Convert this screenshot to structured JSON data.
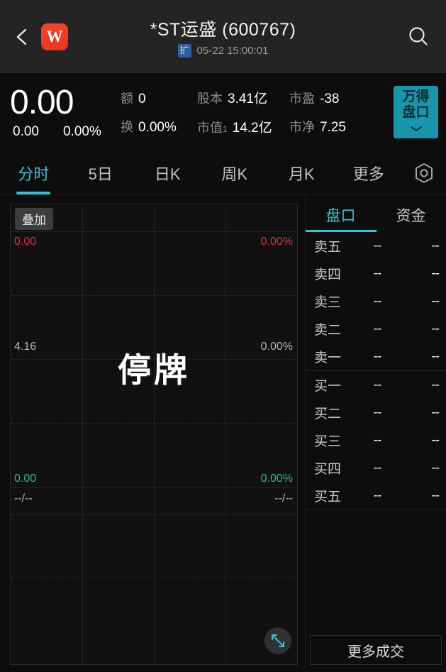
{
  "header": {
    "back_icon": "chevron-left-icon",
    "logo_letter": "W",
    "title": "*ST运盛 (600767)",
    "badge": "扩",
    "timestamp": "05-22 15:00:01",
    "search_icon": "search-icon"
  },
  "quote": {
    "price": "0.00",
    "change": "0.00",
    "change_pct": "0.00%",
    "stats": [
      {
        "key": "额",
        "sup": "",
        "value": "0"
      },
      {
        "key": "换",
        "sup": "",
        "value": "0.00%"
      },
      {
        "key": "股本",
        "sup": "",
        "value": "3.41亿"
      },
      {
        "key": "市值",
        "sup": "1",
        "value": "14.2亿"
      },
      {
        "key": "市盈",
        "sup": "",
        "value": "-38"
      },
      {
        "key": "市净",
        "sup": "",
        "value": "7.25"
      }
    ],
    "wind_button": {
      "line1": "万得",
      "line2": "盘口",
      "chevron": "chevron-down-icon"
    },
    "accent": "#1995ab"
  },
  "tabs": {
    "items": [
      {
        "label": "分时",
        "active": true
      },
      {
        "label": "5日",
        "active": false
      },
      {
        "label": "日K",
        "active": false
      },
      {
        "label": "周K",
        "active": false
      },
      {
        "label": "月K",
        "active": false
      },
      {
        "label": "更多",
        "active": false
      }
    ],
    "settings_icon": "gear-hex-icon",
    "accent": "#2ec5d8"
  },
  "chart": {
    "overlay_button": "叠加",
    "halt_text": "停牌",
    "expand_icon": "expand-diagonal-icon",
    "labels": {
      "top_left": "0.00",
      "top_right": "0.00%",
      "mid_left": "4.16",
      "mid_right": "0.00%",
      "bottom_left": "0.00",
      "bottom_right": "0.00%",
      "vol_left": "--/--",
      "vol_right": "--/--"
    },
    "colors": {
      "up": "#e62e2e",
      "down": "#1fc17b",
      "neutral": "#b5b5b5"
    }
  },
  "chart_data": {
    "type": "line",
    "title": "分时",
    "xlabel": "",
    "ylabel": "",
    "series": [],
    "ylim": [
      4.16,
      4.16
    ],
    "price_axis_labels": [
      "0.00",
      "4.16",
      "0.00"
    ],
    "pct_axis_labels": [
      "0.00%",
      "0.00%",
      "0.00%"
    ],
    "volume_axis_labels": [
      "--/--",
      "--/--"
    ],
    "grid": true,
    "note": "停牌 — trading suspended, no intraday data plotted"
  },
  "panel": {
    "tabs": [
      {
        "label": "盘口",
        "active": true
      },
      {
        "label": "资金",
        "active": false
      }
    ],
    "asks": [
      {
        "level": "卖五",
        "price": "--",
        "volume": "--"
      },
      {
        "level": "卖四",
        "price": "--",
        "volume": "--"
      },
      {
        "level": "卖三",
        "price": "--",
        "volume": "--"
      },
      {
        "level": "卖二",
        "price": "--",
        "volume": "--"
      },
      {
        "level": "卖一",
        "price": "--",
        "volume": "--"
      }
    ],
    "bids": [
      {
        "level": "买一",
        "price": "--",
        "volume": "--"
      },
      {
        "level": "买二",
        "price": "--",
        "volume": "--"
      },
      {
        "level": "买三",
        "price": "--",
        "volume": "--"
      },
      {
        "level": "买四",
        "price": "--",
        "volume": "--"
      },
      {
        "level": "买五",
        "price": "--",
        "volume": "--"
      }
    ],
    "more_button": "更多成交"
  }
}
